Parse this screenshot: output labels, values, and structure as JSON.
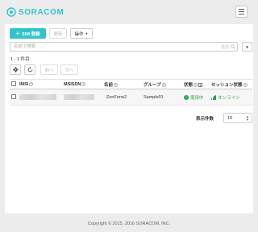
{
  "header": {
    "logo_text": "SORACOM",
    "brand_color": "#34c3c9",
    "menu_icon": "hamburger-icon"
  },
  "toolbar": {
    "register_sim_label": "SIM 登録",
    "refresh_label": "更新",
    "actions_label": "操作"
  },
  "search": {
    "placeholder": "名前で検索",
    "field_label": "名前"
  },
  "result_count": "1 - 1 件目",
  "pager": {
    "prev_label": "前へ",
    "next_label": "次へ"
  },
  "table": {
    "columns": [
      "IMSI",
      "MSISDN",
      "名前",
      "グループ",
      "状態",
      "セッション状態"
    ],
    "rows": [
      {
        "imsi": "",
        "msisdn": "",
        "name": "ZenFone2",
        "group": "Sample01",
        "status": "使用中",
        "session": "オンライン"
      }
    ]
  },
  "per_page": {
    "label": "表示件数",
    "value": "10"
  },
  "footer": {
    "copyright": "Copyright © 2015, 2016 SORACOM, INC."
  },
  "colors": {
    "accent": "#34c3c9",
    "status_ok": "#2aa24a"
  }
}
